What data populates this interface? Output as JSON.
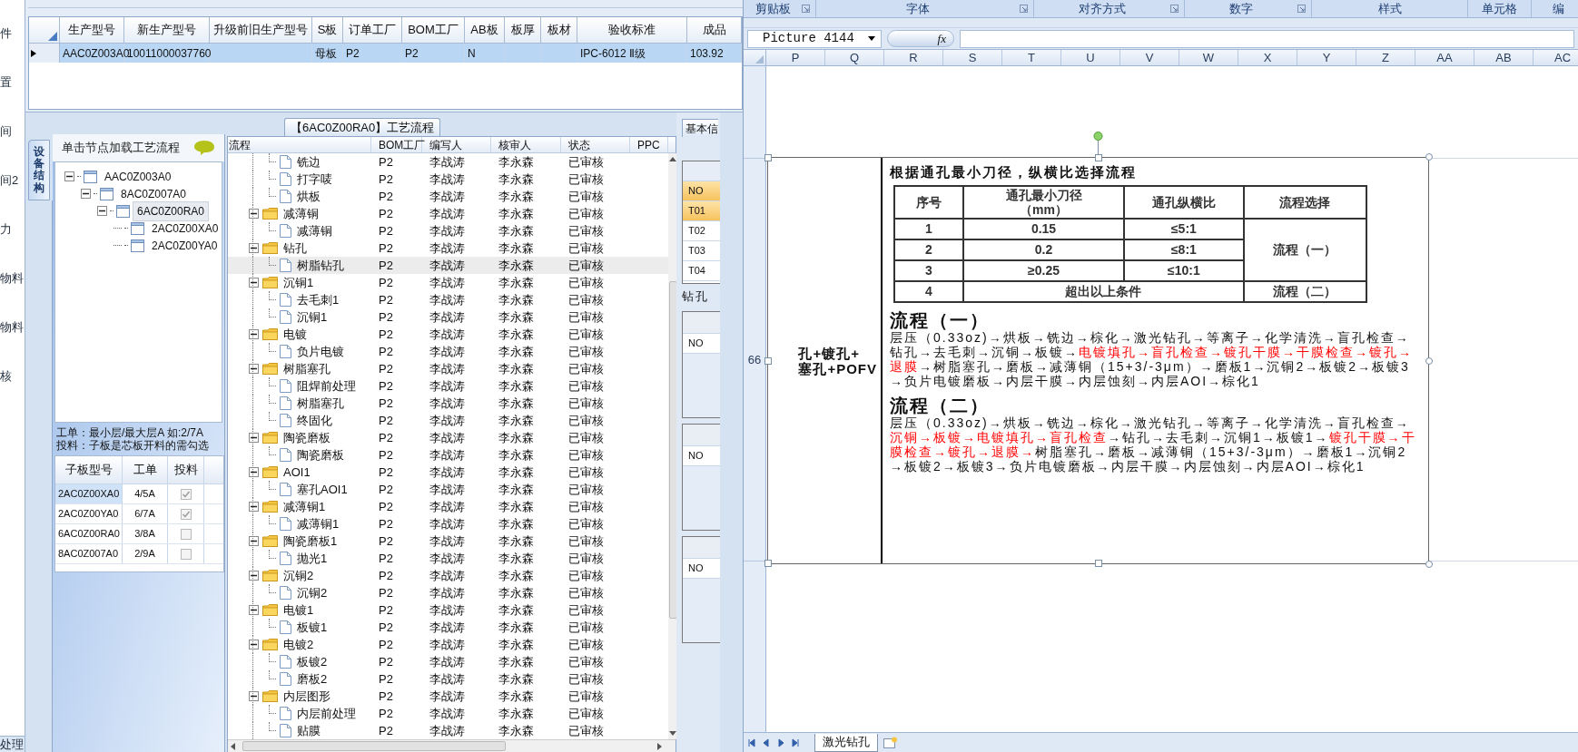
{
  "nav": {
    "items": [
      {
        "label": "件"
      },
      {
        "label": "置"
      },
      {
        "label": "间"
      },
      {
        "label": "间2"
      },
      {
        "label": "力"
      },
      {
        "label": "物料"
      },
      {
        "label": "物料"
      },
      {
        "label": "核"
      }
    ],
    "footer": "处理"
  },
  "order_grid": {
    "columns": [
      "生产型号",
      "新生产型号",
      "升级前旧生产型号",
      "S板",
      "订单工厂",
      "BOM工厂",
      "AB板",
      "板厚",
      "板材",
      "验收标准",
      "成品"
    ],
    "rows": [
      {
        "selected": true,
        "cells": [
          {
            "text": "AAC0Z003A0"
          },
          {
            "text": "10011000037760"
          },
          {},
          {
            "text": "母板"
          },
          {
            "text": "P2"
          },
          {
            "text": "P2"
          },
          {
            "text": "N"
          },
          {},
          {},
          {
            "text": "IPC-6012 Ⅱ级"
          },
          {
            "text": "103.92"
          }
        ]
      }
    ]
  },
  "structure_panel": {
    "tab": "设备结构",
    "hint": "单击节点加载工艺流程",
    "tree": [
      {
        "label": "AAC0Z003A0",
        "selected": false,
        "expanded": true,
        "children": [
          {
            "label": "8AC0Z007A0",
            "selected": false,
            "expanded": true,
            "children": [
              {
                "label": "6AC0Z00RA0",
                "selected": true,
                "expanded": true,
                "children": [
                  {
                    "label": "2AC0Z00XA0",
                    "selected": false
                  },
                  {
                    "label": "2AC0Z00YA0",
                    "selected": false
                  }
                ]
              }
            ]
          }
        ]
      }
    ],
    "notes": [
      "工单：最小层/最大层A 如:2/7A",
      "投料：子板是芯板开料的需勾选"
    ],
    "sub_boards": {
      "columns": [
        "子板型号",
        "工单",
        "投料"
      ],
      "rows": [
        {
          "model": "2AC0Z00XA0",
          "order": "4/5A",
          "checked": true,
          "selected": true
        },
        {
          "model": "2AC0Z00YA0",
          "order": "6/7A",
          "checked": true,
          "selected": false
        },
        {
          "model": "6AC0Z00RA0",
          "order": "3/8A",
          "checked": false,
          "selected": false
        },
        {
          "model": "8AC0Z007A0",
          "order": "2/9A",
          "checked": false,
          "selected": false
        }
      ]
    }
  },
  "process": {
    "title": "【6AC0Z00RA0】工艺流程",
    "columns": [
      "流程",
      "BOM工厂",
      "编写人",
      "核审人",
      "状态",
      "PPC"
    ],
    "rows": [
      {
        "children": [
          {
            "label": "铣边",
            "bom": "P2",
            "writer": "李战涛",
            "reviewer": "李永森",
            "status": "已审核",
            "selected": false
          },
          {
            "label": "打字唛",
            "bom": "P2",
            "writer": "李战涛",
            "reviewer": "李永森",
            "status": "已审核",
            "selected": false
          },
          {
            "label": "烘板",
            "bom": "P2",
            "writer": "李战涛",
            "reviewer": "李永森",
            "status": "已审核",
            "selected": false
          }
        ]
      },
      {
        "label": "减薄铜",
        "bom": "P2",
        "writer": "李战涛",
        "reviewer": "李永森",
        "status": "已审核",
        "selected": false,
        "expanded": true,
        "children": [
          {
            "label": "减薄铜",
            "bom": "P2",
            "writer": "李战涛",
            "reviewer": "李永森",
            "status": "已审核",
            "selected": false
          }
        ]
      },
      {
        "label": "钻孔",
        "bom": "P2",
        "writer": "李战涛",
        "reviewer": "李永森",
        "status": "已审核",
        "selected": false,
        "expanded": true,
        "children": [
          {
            "label": "树脂钻孔",
            "bom": "P2",
            "writer": "李战涛",
            "reviewer": "李永森",
            "status": "已审核",
            "selected": true
          }
        ]
      },
      {
        "label": "沉铜1",
        "bom": "P2",
        "writer": "李战涛",
        "reviewer": "李永森",
        "status": "已审核",
        "selected": false,
        "expanded": true,
        "children": [
          {
            "label": "去毛刺1",
            "bom": "P2",
            "writer": "李战涛",
            "reviewer": "李永森",
            "status": "已审核",
            "selected": false
          },
          {
            "label": "沉铜1",
            "bom": "P2",
            "writer": "李战涛",
            "reviewer": "李永森",
            "status": "已审核",
            "selected": false
          }
        ]
      },
      {
        "label": "电镀",
        "bom": "P2",
        "writer": "李战涛",
        "reviewer": "李永森",
        "status": "已审核",
        "selected": false,
        "expanded": true,
        "children": [
          {
            "label": "负片电镀",
            "bom": "P2",
            "writer": "李战涛",
            "reviewer": "李永森",
            "status": "已审核",
            "selected": false
          }
        ]
      },
      {
        "label": "树脂塞孔",
        "bom": "P2",
        "writer": "李战涛",
        "reviewer": "李永森",
        "status": "已审核",
        "selected": false,
        "expanded": true,
        "children": [
          {
            "label": "阻焊前处理",
            "bom": "P2",
            "writer": "李战涛",
            "reviewer": "李永森",
            "status": "已审核",
            "selected": false
          },
          {
            "label": "树脂塞孔",
            "bom": "P2",
            "writer": "李战涛",
            "reviewer": "李永森",
            "status": "已审核",
            "selected": false
          },
          {
            "label": "终固化",
            "bom": "P2",
            "writer": "李战涛",
            "reviewer": "李永森",
            "status": "已审核",
            "selected": false
          }
        ]
      },
      {
        "label": "陶瓷磨板",
        "bom": "P2",
        "writer": "李战涛",
        "reviewer": "李永森",
        "status": "已审核",
        "selected": false,
        "expanded": true,
        "children": [
          {
            "label": "陶瓷磨板",
            "bom": "P2",
            "writer": "李战涛",
            "reviewer": "李永森",
            "status": "已审核",
            "selected": false
          }
        ]
      },
      {
        "label": "AOI1",
        "bom": "P2",
        "writer": "李战涛",
        "reviewer": "李永森",
        "status": "已审核",
        "selected": false,
        "expanded": true,
        "children": [
          {
            "label": "塞孔AOI1",
            "bom": "P2",
            "writer": "李战涛",
            "reviewer": "李永森",
            "status": "已审核",
            "selected": false
          }
        ]
      },
      {
        "label": "减薄铜1",
        "bom": "P2",
        "writer": "李战涛",
        "reviewer": "李永森",
        "status": "已审核",
        "selected": false,
        "expanded": true,
        "children": [
          {
            "label": "减薄铜1",
            "bom": "P2",
            "writer": "李战涛",
            "reviewer": "李永森",
            "status": "已审核",
            "selected": false
          }
        ]
      },
      {
        "label": "陶瓷磨板1",
        "bom": "P2",
        "writer": "李战涛",
        "reviewer": "李永森",
        "status": "已审核",
        "selected": false,
        "expanded": true,
        "children": [
          {
            "label": "抛光1",
            "bom": "P2",
            "writer": "李战涛",
            "reviewer": "李永森",
            "status": "已审核",
            "selected": false
          }
        ]
      },
      {
        "label": "沉铜2",
        "bom": "P2",
        "writer": "李战涛",
        "reviewer": "李永森",
        "status": "已审核",
        "selected": false,
        "expanded": true,
        "children": [
          {
            "label": "沉铜2",
            "bom": "P2",
            "writer": "李战涛",
            "reviewer": "李永森",
            "status": "已审核",
            "selected": false
          }
        ]
      },
      {
        "label": "电镀1",
        "bom": "P2",
        "writer": "李战涛",
        "reviewer": "李永森",
        "status": "已审核",
        "selected": false,
        "expanded": true,
        "children": [
          {
            "label": "板镀1",
            "bom": "P2",
            "writer": "李战涛",
            "reviewer": "李永森",
            "status": "已审核",
            "selected": false
          }
        ]
      },
      {
        "label": "电镀2",
        "bom": "P2",
        "writer": "李战涛",
        "reviewer": "李永森",
        "status": "已审核",
        "selected": false,
        "expanded": true,
        "children": [
          {
            "label": "板镀2",
            "bom": "P2",
            "writer": "李战涛",
            "reviewer": "李永森",
            "status": "已审核",
            "selected": false
          },
          {
            "label": "磨板2",
            "bom": "P2",
            "writer": "李战涛",
            "reviewer": "李永森",
            "status": "已审核",
            "selected": false
          }
        ]
      },
      {
        "label": "内层图形",
        "bom": "P2",
        "writer": "李战涛",
        "reviewer": "李永森",
        "status": "已审核",
        "selected": false,
        "expanded": true,
        "children": [
          {
            "label": "内层前处理",
            "bom": "P2",
            "writer": "李战涛",
            "reviewer": "李永森",
            "status": "已审核",
            "selected": false
          },
          {
            "label": "贴膜",
            "bom": "P2",
            "writer": "李战涛",
            "reviewer": "李永森",
            "status": "已审核",
            "selected": false
          }
        ]
      }
    ]
  },
  "side_panel": {
    "tab": "基本信",
    "drill_grid": {
      "header": "NO",
      "rows": [
        {
          "label": "T01",
          "selected": true
        },
        {
          "label": "T02",
          "selected": false
        },
        {
          "label": "T03",
          "selected": false
        },
        {
          "label": "T04",
          "selected": false
        }
      ]
    },
    "section_label": "钻孔",
    "sub_grids": [
      {
        "header": "NO"
      },
      {
        "header": "NO"
      },
      {
        "header": "NO"
      }
    ]
  },
  "spreadsheet": {
    "ribbon_groups": [
      {
        "label": "剪贴板",
        "launcher": true
      },
      {
        "label": "字体",
        "launcher": true
      },
      {
        "label": "对齐方式",
        "launcher": true
      },
      {
        "label": "数字",
        "launcher": true
      },
      {
        "label": "样式",
        "launcher": false
      },
      {
        "label": "单元格",
        "launcher": false
      },
      {
        "label": "编",
        "launcher": false
      }
    ],
    "name_box": "Picture 4144",
    "function_button": "fx",
    "columns": [
      "P",
      "Q",
      "R",
      "S",
      "T",
      "U",
      "V",
      "W",
      "X",
      "Y",
      "Z",
      "AA",
      "AB",
      "AC"
    ],
    "row_number": "66",
    "picture": {
      "cell_lines": [
        "孔+镀孔+",
        "塞孔+POFV"
      ],
      "title": "根据通孔最小刀径，纵横比选择流程",
      "table": {
        "columns": [
          "序号",
          "通孔最小刀径（mm）",
          "通孔纵横比",
          "流程选择"
        ],
        "rows": [
          {
            "no": "1",
            "diameter": "0.15",
            "ratio": "≤5:1"
          },
          {
            "no": "2",
            "diameter": "0.2",
            "ratio": "≤8:1"
          },
          {
            "no": "3",
            "diameter": "≥0.25",
            "ratio": "≤10:1"
          }
        ],
        "group_choice": "流程（一）",
        "last_row": {
          "no": "4",
          "condition": "超出以上条件",
          "choice": "流程（二）"
        }
      },
      "flows": [
        {
          "heading": "流程（一）",
          "segments": [
            {
              "text": "层压（0.33oz)→烘板→铣边→棕化→激光钻孔→等离子→化学清洗→盲孔检查→钻孔→去毛刺→沉铜→板镀→",
              "marked": false
            },
            {
              "text": "电镀填孔→盲孔检查→镀孔干膜→干膜检查→镀孔→退膜",
              "marked": true
            },
            {
              "text": "→树脂塞孔→磨板→减薄铜（15+3/-3μm）→磨板1→沉铜2→板镀2→板镀3→负片电镀磨板→内层干膜→内层蚀刻→内层AOI→棕化1",
              "marked": false
            }
          ]
        },
        {
          "heading": "流程（二）",
          "segments": [
            {
              "text": "层压（0.33oz)→烘板→铣边→棕化→激光钻孔→等离子→化学清洗→盲孔检查→",
              "marked": false
            },
            {
              "text": "沉铜→板镀→电镀填孔→盲孔检查",
              "marked": true
            },
            {
              "text": "→钻孔→去毛刺→沉铜1→板镀1→",
              "marked": false
            },
            {
              "text": "镀孔干膜→干膜检查→镀孔→退膜→",
              "marked": true
            },
            {
              "text": "树脂塞孔→磨板→减薄铜（15+3/-3μm）→磨板1→沉铜2→板镀2→板镀3→负片电镀磨板→内层干膜→内层蚀刻→内层AOI→棕化1",
              "marked": false
            }
          ]
        }
      ]
    },
    "sheet_tabs": [
      {
        "label": "激光钻孔",
        "selected": true
      }
    ]
  }
}
